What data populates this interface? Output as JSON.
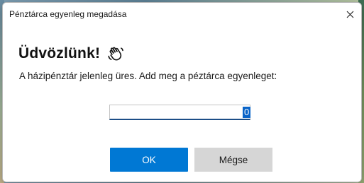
{
  "window": {
    "title": "Pénztárca egyenleg megadása"
  },
  "content": {
    "welcome": "Üdvözlünk!",
    "welcome_icon": "waving-hand-icon",
    "prompt": "A házipénztár jelenleg üres. Add meg a péztárca egyenleget:",
    "balance_value": "0"
  },
  "buttons": {
    "ok": "OK",
    "cancel": "Mégse"
  },
  "colors": {
    "primary": "#0078d4",
    "secondary": "#d6d6d6",
    "selection": "#0a64c8"
  }
}
